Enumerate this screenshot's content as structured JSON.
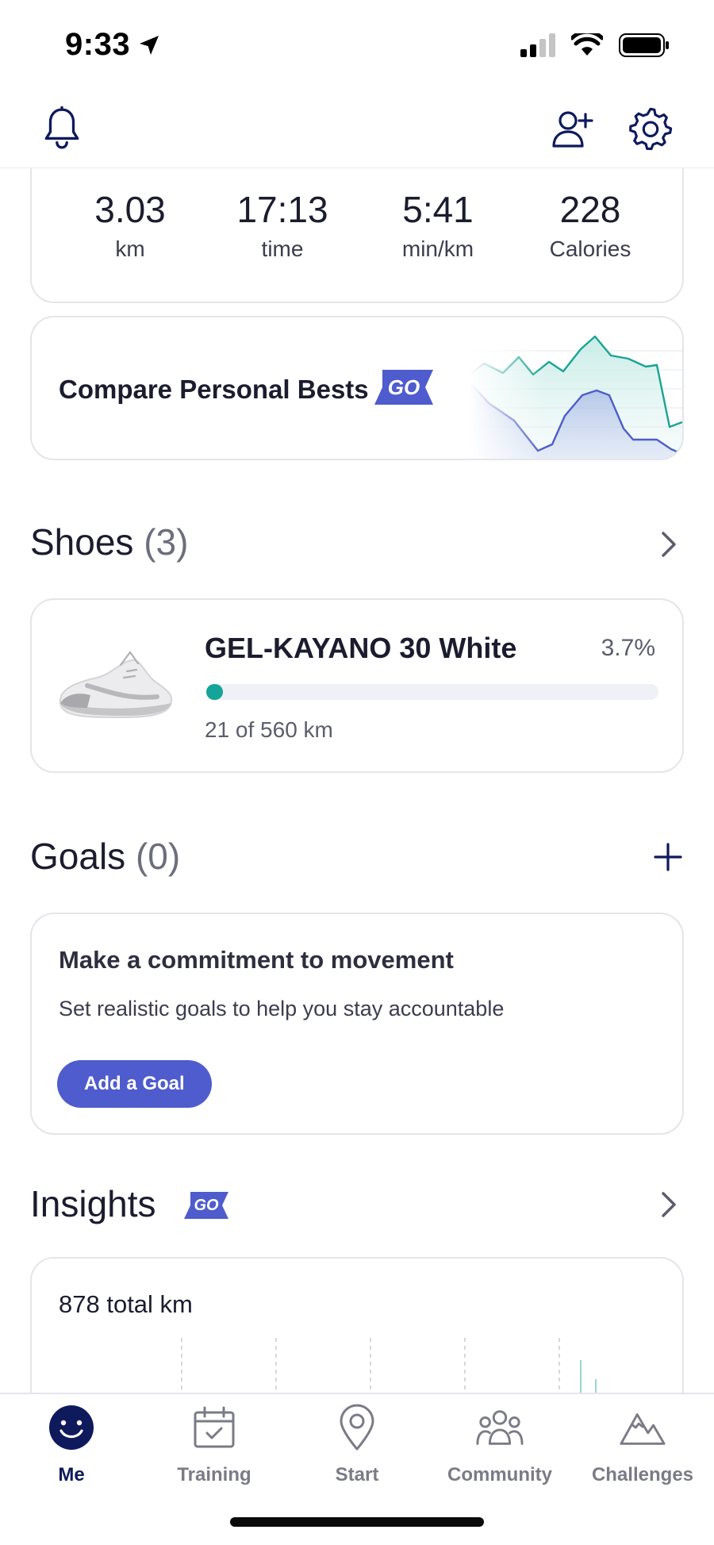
{
  "status_bar": {
    "time": "9:33"
  },
  "stats": [
    {
      "value": "3.03",
      "unit": "km"
    },
    {
      "value": "17:13",
      "unit": "time"
    },
    {
      "value": "5:41",
      "unit": "min/km"
    },
    {
      "value": "228",
      "unit": "Calories"
    }
  ],
  "compare": {
    "label": "Compare Personal Bests",
    "badge": "GO"
  },
  "shoes": {
    "title": "Shoes",
    "count": "(3)",
    "item": {
      "name": "GEL-KAYANO 30 White",
      "percent": "3.7%",
      "progress_fraction": 0.037,
      "distance": "21 of 560 km"
    }
  },
  "goals": {
    "title": "Goals",
    "count": "(0)",
    "card_title": "Make a commitment to movement",
    "card_desc": "Set realistic goals to help you stay accountable",
    "button": "Add a Goal"
  },
  "insights": {
    "title": "Insights",
    "badge": "GO",
    "total": "878 total km"
  },
  "tabs": [
    {
      "label": "Me",
      "icon": "smiley-icon",
      "active": true
    },
    {
      "label": "Training",
      "icon": "calendar-icon",
      "active": false
    },
    {
      "label": "Start",
      "icon": "map-pin-icon",
      "active": false
    },
    {
      "label": "Community",
      "icon": "people-icon",
      "active": false
    },
    {
      "label": "Challenges",
      "icon": "mountain-icon",
      "active": false
    }
  ],
  "colors": {
    "accent": "#4f5ccd",
    "navy": "#0e1a5c",
    "teal": "#14a49a",
    "text": "#1b1c2e",
    "muted": "#6d6e7c"
  }
}
